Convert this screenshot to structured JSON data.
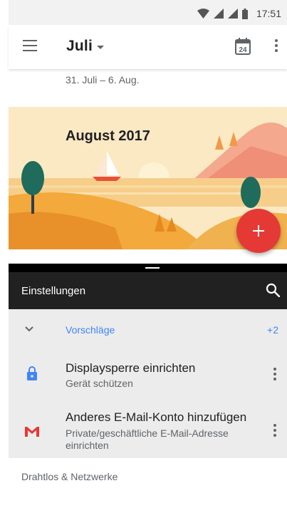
{
  "status_bar": {
    "time": "17:51"
  },
  "calendar": {
    "month_title": "Juli",
    "week_range": "31. Juli – 6. Aug.",
    "today_day": "24",
    "illustration_title": "August 2017",
    "fab_symbol": "+"
  },
  "settings": {
    "title": "Einstellungen",
    "suggestions": {
      "label": "Vorschläge",
      "count": "+2",
      "items": [
        {
          "title": "Displaysperre einrichten",
          "subtitle": "Gerät schützen",
          "icon": "lock-icon"
        },
        {
          "title": "Anderes E-Mail-Konto hinzufügen",
          "subtitle": "Private/geschäftliche E-Mail-Adresse einrichten",
          "icon": "gmail-icon"
        }
      ]
    },
    "section_header": "Drahtlos & Netzwerke"
  },
  "colors": {
    "accent_blue": "#4285f4",
    "fab_red": "#e53935",
    "toolbar_dark": "#212121"
  }
}
